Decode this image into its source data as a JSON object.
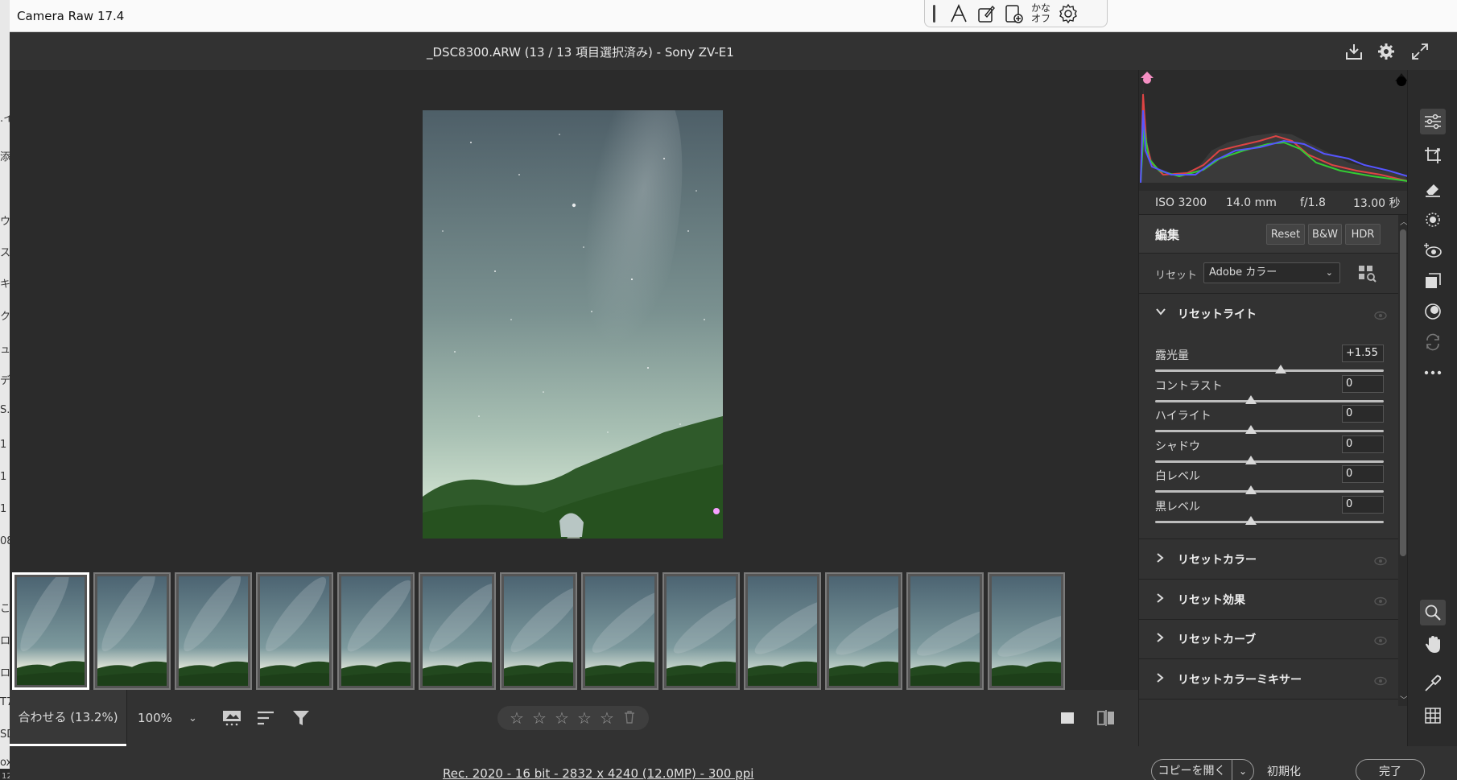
{
  "window": {
    "app_title": "Camera Raw 17.4"
  },
  "ime_bar": {
    "kana_line1": "かな",
    "kana_line2": "オフ"
  },
  "header": {
    "doc_title": "_DSC8300.ARW (13 / 13 項目選択済み)  -  Sony ZV-E1"
  },
  "background_app_chars": [
    ".イ",
    "添",
    "ウ",
    "ス",
    "キ",
    "ク",
    "ュ",
    "デ",
    "S.\\",
    "1",
    "1",
    "1",
    "08",
    "こ",
    "ロ",
    "ロ",
    "T7",
    "SD",
    "ox"
  ],
  "background_bottom_text": "12 個の項",
  "filmstrip": {
    "count": 13,
    "selected_index": 0
  },
  "bottom_toolbar": {
    "fit_label": "合わせる (13.2%)",
    "zoom_label": "100%",
    "rating_stars": 5
  },
  "status": {
    "render_info": "Rec. 2020 - 16 bit - 2832 x 4240 (12.0MP) - 300 ppi",
    "open_copy_label": "コピーを開く",
    "reset_label": "初期化",
    "done_label": "完了"
  },
  "exif": {
    "iso": "ISO 3200",
    "focal": "14.0 mm",
    "aperture": "f/1.8",
    "shutter": "13.00 秒"
  },
  "edit_panel": {
    "title": "編集",
    "reset_btn": "Reset",
    "bw_btn": "B&W",
    "hdr_btn": "HDR",
    "preset_label": "リセット",
    "preset_value": "Adobe カラー",
    "light_section": "リセットライト",
    "sliders": [
      {
        "name": "露光量",
        "value": "+1.55",
        "position": 0.55
      },
      {
        "name": "コントラスト",
        "value": "0",
        "position": 0.42
      },
      {
        "name": "ハイライト",
        "value": "0",
        "position": 0.42
      },
      {
        "name": "シャドウ",
        "value": "0",
        "position": 0.42
      },
      {
        "name": "白レベル",
        "value": "0",
        "position": 0.42
      },
      {
        "name": "黒レベル",
        "value": "0",
        "position": 0.42
      }
    ],
    "sections": [
      {
        "title": "リセットカラー"
      },
      {
        "title": "リセット効果"
      },
      {
        "title": "リセットカーブ"
      },
      {
        "title": "リセットカラーミキサー"
      }
    ]
  },
  "colors": {
    "panel": "#323232",
    "canvas": "#2b2b2b",
    "accent_pink": "#f06eb4"
  }
}
